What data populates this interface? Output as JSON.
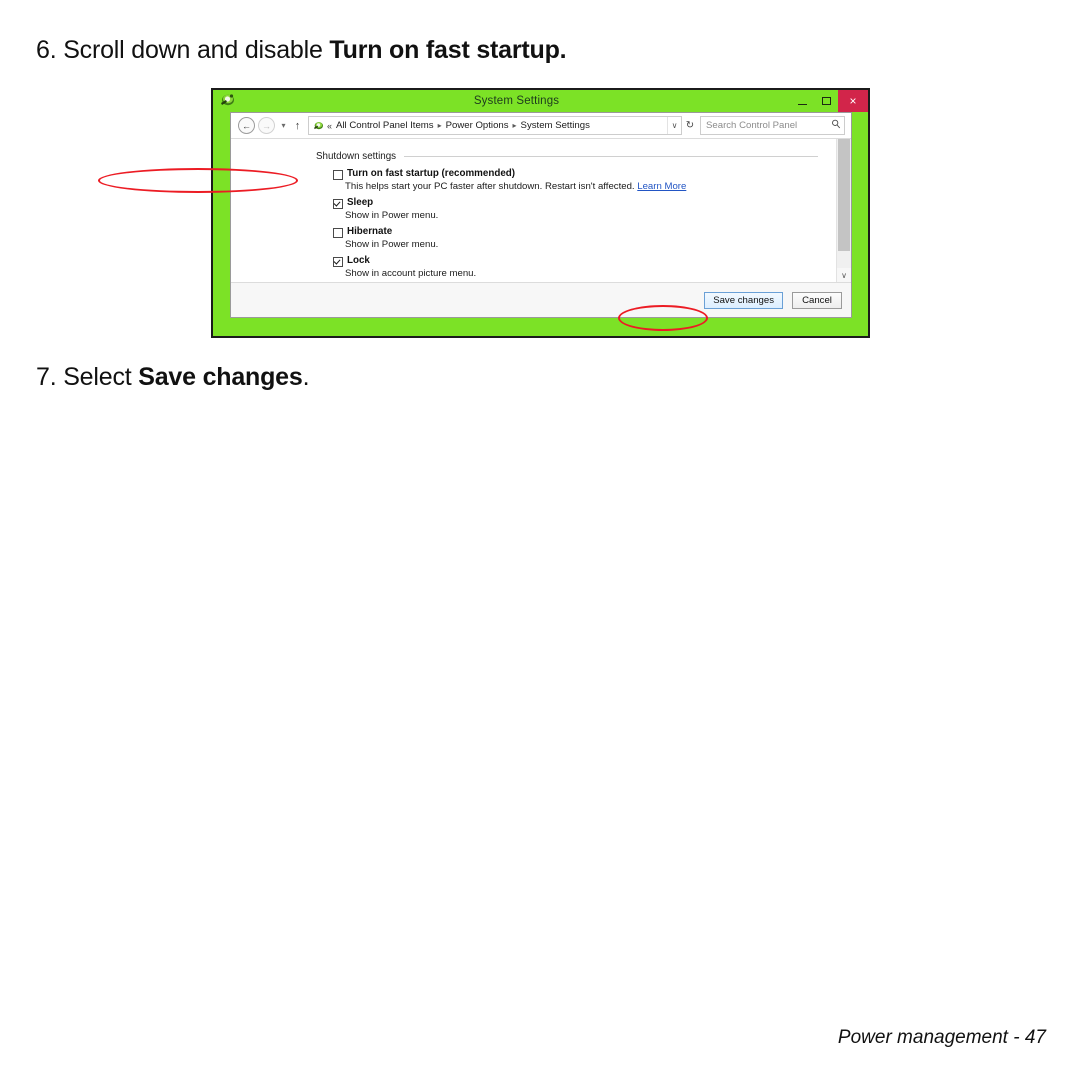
{
  "doc": {
    "step6": {
      "number": "6.",
      "text_before": "Scroll down and disable ",
      "bold": "Turn on fast startup."
    },
    "step7": {
      "number": "7.",
      "text_before": "Select ",
      "bold": "Save changes",
      "text_after": "."
    },
    "footer": {
      "section": "Power management -",
      "page": "47"
    }
  },
  "window": {
    "title": "System Settings",
    "icon": "control-panel-icon",
    "caption": {
      "minimize": "–",
      "maximize": "□",
      "close": "×"
    },
    "frame_color": "#7ce226",
    "close_color": "#d2254a"
  },
  "navbar": {
    "back": "←",
    "forward": "→",
    "recent": "▾",
    "up": "↑",
    "breadcrumb": {
      "overflow": "«",
      "items": [
        "All Control Panel Items",
        "Power Options",
        "System Settings"
      ],
      "separator": "▸",
      "dropdown": "∨"
    },
    "refresh": "↻",
    "search": {
      "placeholder": "Search Control Panel",
      "icon": "search-icon"
    }
  },
  "content": {
    "group_title": "Shutdown settings",
    "options": [
      {
        "label": "Turn on fast startup (recommended)",
        "checked": false,
        "desc_prefix": "This helps start your PC faster after shutdown. Restart isn't affected. ",
        "link": "Learn More",
        "highlighted": true
      },
      {
        "label": "Sleep",
        "checked": true,
        "desc_prefix": "Show in Power menu.",
        "link": "",
        "highlighted": false
      },
      {
        "label": "Hibernate",
        "checked": false,
        "desc_prefix": "Show in Power menu.",
        "link": "",
        "highlighted": false
      },
      {
        "label": "Lock",
        "checked": true,
        "desc_prefix": "Show in account picture menu.",
        "link": "",
        "highlighted": false
      }
    ],
    "scrollbar": {
      "down_arrow": "∨"
    }
  },
  "buttons": {
    "save": "Save changes",
    "cancel": "Cancel",
    "highlight_color": "#ec1c24"
  }
}
